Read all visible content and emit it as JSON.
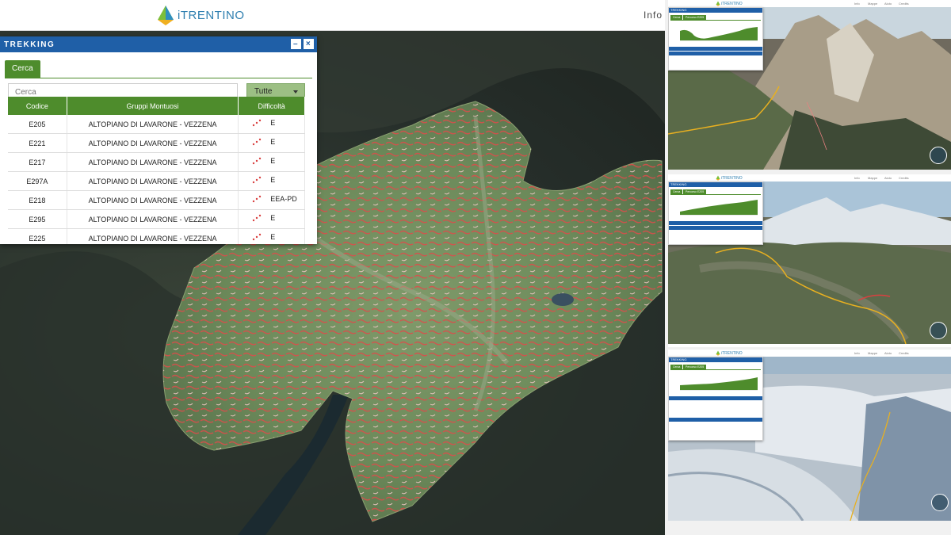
{
  "header": {
    "logo_text": "iTRENTINO",
    "nav_info": "Info"
  },
  "panel": {
    "title": "TREKKING",
    "minimize_label": "–",
    "close_label": "×",
    "tab_label": "Cerca",
    "search_placeholder": "Cerca",
    "select_value": "Tutte",
    "columns": [
      "Codice",
      "Gruppi Montuosi",
      "Difficoltà"
    ],
    "rows": [
      {
        "code": "E205",
        "group": "ALTOPIANO DI LAVARONE - VEZZENA",
        "difficulty": "E"
      },
      {
        "code": "E221",
        "group": "ALTOPIANO DI LAVARONE - VEZZENA",
        "difficulty": "E"
      },
      {
        "code": "E217",
        "group": "ALTOPIANO DI LAVARONE - VEZZENA",
        "difficulty": "E"
      },
      {
        "code": "E297A",
        "group": "ALTOPIANO DI LAVARONE - VEZZENA",
        "difficulty": "E"
      },
      {
        "code": "E218",
        "group": "ALTOPIANO DI LAVARONE - VEZZENA",
        "difficulty": "EEA-PD"
      },
      {
        "code": "E295",
        "group": "ALTOPIANO DI LAVARONE - VEZZENA",
        "difficulty": "E"
      },
      {
        "code": "E225",
        "group": "ALTOPIANO DI LAVARONE - VEZZENA",
        "difficulty": "E"
      }
    ]
  },
  "screenshots": [
    {
      "logo": "iTRENTINO",
      "panel_title": "TREKKING",
      "tab1": "Cerca",
      "tab2": "Percorso E205",
      "nav": [
        "Info",
        "Mappe",
        "Aiuto",
        "Credits"
      ]
    },
    {
      "logo": "iTRENTINO",
      "panel_title": "TREKKING",
      "tab1": "Cerca",
      "tab2": "Percorso E205",
      "nav": [
        "Info",
        "Mappe",
        "Aiuto",
        "Credits"
      ]
    },
    {
      "logo": "iTRENTINO",
      "panel_title": "TREKKING",
      "tab1": "Cerca",
      "tab2": "Percorso E205",
      "nav": [
        "Info",
        "Mappe",
        "Aiuto",
        "Credits"
      ]
    }
  ],
  "colors": {
    "header_blue": "#1f5fa7",
    "accent_green": "#4e8c2c",
    "trail_red": "#d94040",
    "trail_yellow": "#e8b020"
  }
}
